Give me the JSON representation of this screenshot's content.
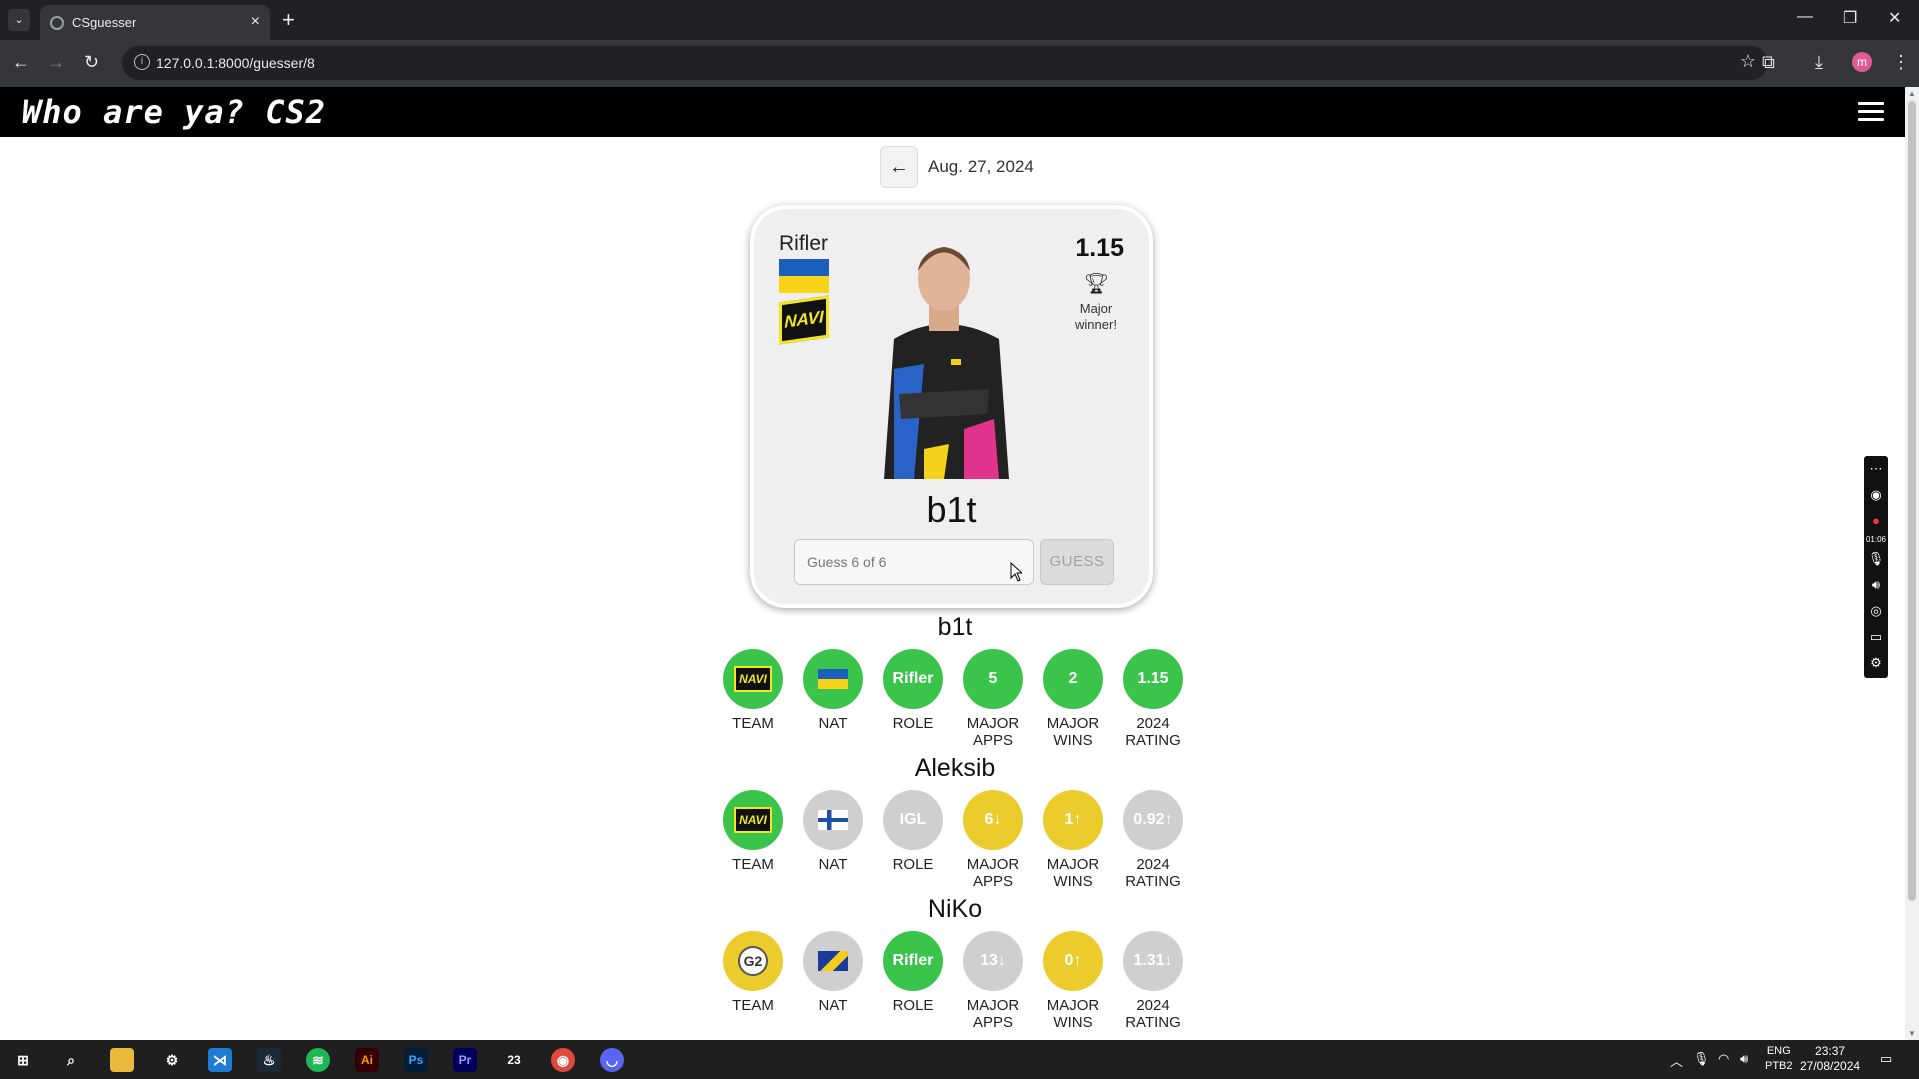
{
  "browser": {
    "tab_title": "CSguesser",
    "url": "127.0.0.1:8000/guesser/8",
    "profile_initial": "m"
  },
  "site": {
    "logo_text": "Who are ya? CS2"
  },
  "date": {
    "label": "Aug. 27, 2024"
  },
  "card": {
    "role": "Rifler",
    "rating": "1.15",
    "major_text": "Major winner!",
    "player_name": "b1t",
    "input_placeholder": "Guess 6 of 6",
    "guess_label": "GUESS",
    "team_logo_text": "NAVI"
  },
  "labels": {
    "team": "TEAM",
    "nat": "NAT",
    "role": "ROLE",
    "major_apps": "MAJOR APPS",
    "major_wins": "MAJOR WINS",
    "rating_2024": "2024 RATING"
  },
  "guesses": [
    {
      "name": "b1t",
      "team": {
        "status": "green",
        "logo": "NAVI"
      },
      "nat": {
        "status": "green",
        "flag": "ukraine"
      },
      "role": {
        "status": "green",
        "value": "Rifler"
      },
      "major_apps": {
        "status": "green",
        "value": "5"
      },
      "major_wins": {
        "status": "green",
        "value": "2"
      },
      "rating": {
        "status": "green",
        "value": "1.15"
      }
    },
    {
      "name": "Aleksib",
      "team": {
        "status": "green",
        "logo": "NAVI"
      },
      "nat": {
        "status": "grey",
        "flag": "finland"
      },
      "role": {
        "status": "grey",
        "value": "IGL"
      },
      "major_apps": {
        "status": "yellow",
        "value": "6↓"
      },
      "major_wins": {
        "status": "yellow",
        "value": "1↑"
      },
      "rating": {
        "status": "grey",
        "value": "0.92↑"
      }
    },
    {
      "name": "NiKo",
      "team": {
        "status": "yellow",
        "logo": "G2"
      },
      "nat": {
        "status": "grey",
        "flag": "bosnia"
      },
      "role": {
        "status": "green",
        "value": "Rifler"
      },
      "major_apps": {
        "status": "grey",
        "value": "13↓"
      },
      "major_wins": {
        "status": "yellow",
        "value": "0↑"
      },
      "rating": {
        "status": "grey",
        "value": "1.31↓"
      }
    }
  ],
  "taskbar": {
    "lang_line1": "ENG",
    "lang_line2": "PTB2",
    "time": "23:37",
    "date": "27/08/2024",
    "recorder_time": "01:06"
  },
  "colors": {
    "green": "#3bc44b",
    "yellow": "#eccc2d",
    "grey": "#cfcfcf"
  }
}
